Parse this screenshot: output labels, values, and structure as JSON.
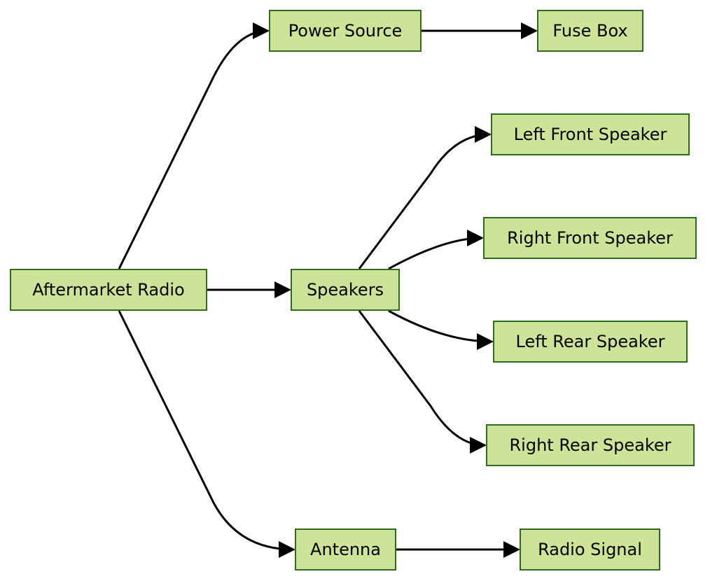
{
  "colors": {
    "node_fill": "#cde498",
    "node_border": "#2e6b1f",
    "edge": "#000000"
  },
  "nodes": {
    "aftermarket_radio": "Aftermarket Radio",
    "power_source": "Power Source",
    "fuse_box": "Fuse Box",
    "speakers": "Speakers",
    "antenna": "Antenna",
    "left_front": "Left Front Speaker",
    "right_front": "Right Front Speaker",
    "left_rear": "Left Rear Speaker",
    "right_rear": "Right Rear Speaker",
    "radio_signal": "Radio Signal"
  },
  "edges": [
    [
      "aftermarket_radio",
      "power_source"
    ],
    [
      "aftermarket_radio",
      "speakers"
    ],
    [
      "aftermarket_radio",
      "antenna"
    ],
    [
      "power_source",
      "fuse_box"
    ],
    [
      "speakers",
      "left_front"
    ],
    [
      "speakers",
      "right_front"
    ],
    [
      "speakers",
      "left_rear"
    ],
    [
      "speakers",
      "right_rear"
    ],
    [
      "antenna",
      "radio_signal"
    ]
  ]
}
